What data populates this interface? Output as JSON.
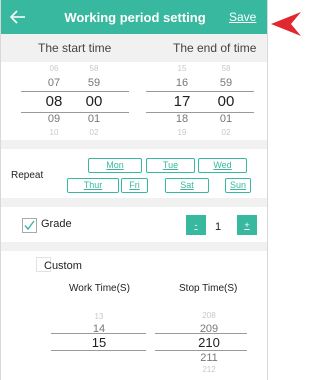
{
  "header": {
    "title": "Working period setting",
    "save_label": "Save"
  },
  "columns": {
    "start": "The start time",
    "end": "The end of time"
  },
  "start_hours": [
    "06",
    "07",
    "08",
    "09",
    "10"
  ],
  "start_minutes": [
    "58",
    "59",
    "00",
    "01",
    "02"
  ],
  "end_hours": [
    "15",
    "16",
    "17",
    "18",
    "19"
  ],
  "end_minutes": [
    "58",
    "59",
    "00",
    "01",
    "02"
  ],
  "repeat": {
    "label": "Repeat",
    "days": [
      "Mon",
      "Tue",
      "Wed",
      "Thur",
      "Fri",
      "Sat",
      "Sun"
    ]
  },
  "grade": {
    "label": "Grade",
    "value": "1",
    "checked": true,
    "minus": "-",
    "plus": "+"
  },
  "custom": {
    "label": "Custom",
    "checked": false
  },
  "times": {
    "work_label": "Work Time(S)",
    "stop_label": "Stop Time(S)",
    "work_values": [
      "13",
      "14",
      "15"
    ],
    "stop_values": [
      "208",
      "209",
      "210",
      "211",
      "212"
    ]
  },
  "colors": {
    "accent": "#39b8a0",
    "arrow": "#e0282e"
  }
}
